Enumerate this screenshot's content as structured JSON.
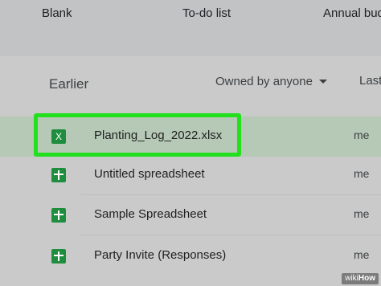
{
  "templates": [
    {
      "label": "Blank"
    },
    {
      "label": "To-do list"
    },
    {
      "label": "Annual budg"
    }
  ],
  "section": {
    "title": "Earlier"
  },
  "filter": {
    "owner_label": "Owned by anyone",
    "last_col": "Last"
  },
  "files": [
    {
      "name": "Planting_Log_2022.xlsx",
      "owner": "me",
      "icon": "excel-file-icon",
      "icon_text": "X",
      "selected": true
    },
    {
      "name": "Untitled spreadsheet",
      "owner": "me",
      "icon": "sheets-icon",
      "selected": false
    },
    {
      "name": "Sample Spreadsheet",
      "owner": "me",
      "icon": "sheets-icon",
      "selected": false
    },
    {
      "name": "Party Invite (Responses)",
      "owner": "me",
      "icon": "sheets-icon",
      "selected": false
    }
  ],
  "watermark": {
    "prefix": "wiki",
    "brand": "How"
  },
  "colors": {
    "highlight": "#22e01d",
    "sheets_green": "#1e8e3e",
    "selected_row": "#b6c9b6"
  }
}
